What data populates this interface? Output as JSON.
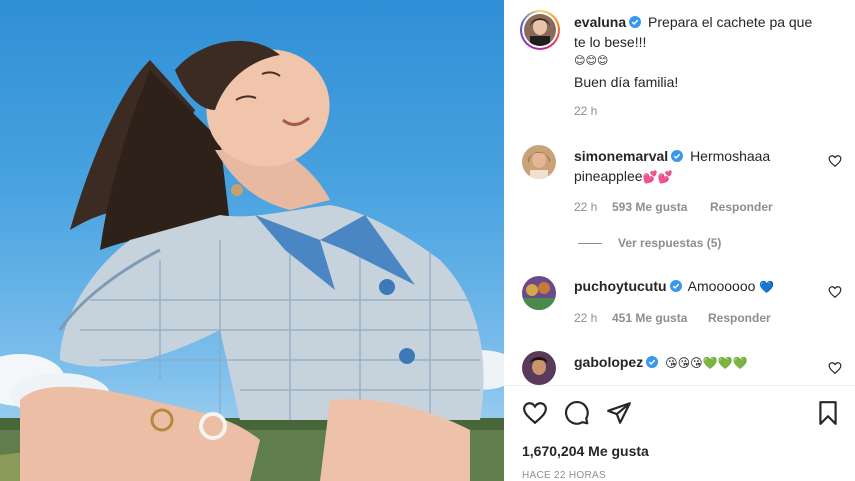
{
  "post": {
    "author": "evaluna",
    "caption_line1": "Prepara el cachete pa que",
    "caption_line2": "te lo bese!!!",
    "caption_emoji": "😊😊😊",
    "caption_line3": "Buen día familia!",
    "time": "22 h"
  },
  "comments": [
    {
      "username": "simonemarval",
      "text_line1": "Hermoshaaa",
      "text_line2": "pineapplee",
      "emoji": "💕💕",
      "time": "22 h",
      "likes": "593 Me gusta",
      "reply_label": "Responder"
    },
    {
      "username": "puchoytucutu",
      "text_line1": "Amoooooo",
      "emoji": "💙",
      "time": "22 h",
      "likes": "451 Me gusta",
      "reply_label": "Responder"
    },
    {
      "username": "gabolopez",
      "emoji": "😘😘😘💚💚💚"
    }
  ],
  "view_replies": "Ver respuestas (5)",
  "footer": {
    "likes": "1,670,204 Me gusta",
    "time_ago": "HACE 22 HORAS"
  },
  "icons": {
    "like": "heart-icon",
    "comment": "comment-icon",
    "share": "send-icon",
    "save": "bookmark-icon",
    "verified": "verified-badge-icon"
  },
  "colors": {
    "verified": "#3897f0",
    "text": "#262626",
    "muted": "#8e8e8e"
  }
}
